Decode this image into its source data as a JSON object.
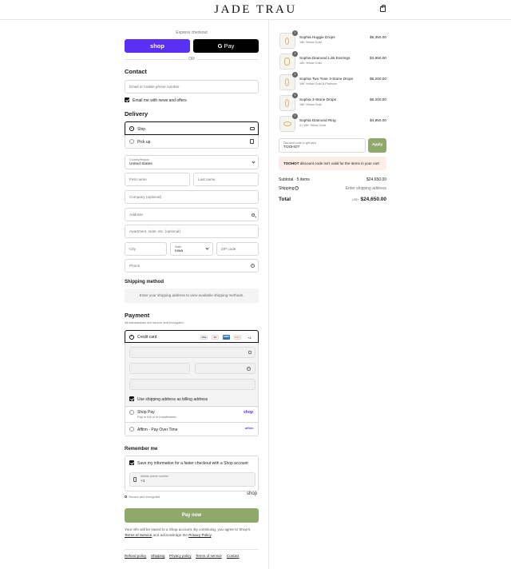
{
  "header": {
    "brand": "JADE TRAU",
    "bag_icon": "shopping-bag-icon"
  },
  "express": {
    "title": "Express checkout",
    "shop_label": "shop",
    "gpay_g": "G",
    "gpay_label": "Pay",
    "or_label": "OR"
  },
  "contact": {
    "title": "Contact",
    "email_placeholder": "Email or mobile phone number",
    "news_label": "Email me with news and offers"
  },
  "delivery": {
    "title": "Delivery",
    "ship_label": "Ship",
    "pickup_label": "Pick up",
    "country_label": "Country/Region",
    "country_value": "United States",
    "first_name": "First name",
    "last_name": "Last name",
    "company": "Company (optional)",
    "address": "Address",
    "apartment": "Apartment, suite, etc. (optional)",
    "city": "City",
    "state_label": "State",
    "state_value": "Iowa",
    "zip": "ZIP code",
    "phone": "Phone"
  },
  "shipping_method": {
    "title": "Shipping method",
    "message": "Enter your shipping address to view available shipping methods."
  },
  "payment": {
    "title": "Payment",
    "subtitle": "All transactions are secure and encrypted.",
    "credit_card_label": "Credit card",
    "cards": [
      "VISA",
      "MC",
      "AMEX",
      "DISC"
    ],
    "more_cards": "+4",
    "billing_label": "Use shipping address as billing address",
    "shop_pay_label": "Shop Pay",
    "shop_pay_sub": "Pay in full or in installments",
    "shop_pay_logo": "shop",
    "affirm_label": "Affirm - Pay Over Time",
    "affirm_logo": "affirm"
  },
  "remember": {
    "title": "Remember me",
    "save_label": "Save my information for a faster checkout with a Shop account",
    "mobile_label": "Mobile phone number",
    "mobile_value": "+1",
    "secure_label": "Secure and encrypted",
    "shop_logo": "shop"
  },
  "pay_now": "Pay now",
  "legal": {
    "prefix": "Your info will be saved to a Shop account. By continuing, you agree to Shop's",
    "terms": "Terms of Service",
    "middle": "and acknowledge the",
    "privacy": "Privacy Policy",
    "suffix": "."
  },
  "footer_links": [
    "Refund policy",
    "Shipping",
    "Privacy policy",
    "Terms of service",
    "Contact"
  ],
  "cart": {
    "items": [
      {
        "qty": "1",
        "name": "Sophia Huggie Drops",
        "variant": "18K Yellow Gold",
        "price": "$5,350.00"
      },
      {
        "qty": "1",
        "name": "Sophia Diamond Link Earrings",
        "variant": "18K Yellow Gold",
        "price": "$3,950.00"
      },
      {
        "qty": "1",
        "name": "Sophia Two Tone 3-Stone Drops",
        "variant": "18K Yellow Gold & Platinum",
        "price": "$5,200.00"
      },
      {
        "qty": "1",
        "name": "Sophia 3-Stone Drops",
        "variant": "18K Yellow Gold",
        "price": "$5,200.00"
      },
      {
        "qty": "1",
        "name": "Sophia Diamond Ring",
        "variant": "4 / 18K Yellow Gold",
        "price": "$4,950.00"
      }
    ],
    "discount_label": "Discount code or gift card",
    "discount_value": "TOOHOT",
    "apply": "Apply",
    "error_code": "TOOHOT",
    "error_text": "discount code isn't valid for the items in your cart",
    "subtotal_label": "Subtotal · 5 items",
    "subtotal_value": "$24,650.00",
    "shipping_label": "Shipping",
    "shipping_value": "Enter shipping address",
    "total_label": "Total",
    "currency": "USD",
    "total_value": "$24,650.00"
  },
  "colors": {
    "shop_purple": "#5a31f4",
    "apply_green": "#8fa96b",
    "pay_green": "#8fa96b",
    "error_bg": "#fbeee6"
  }
}
